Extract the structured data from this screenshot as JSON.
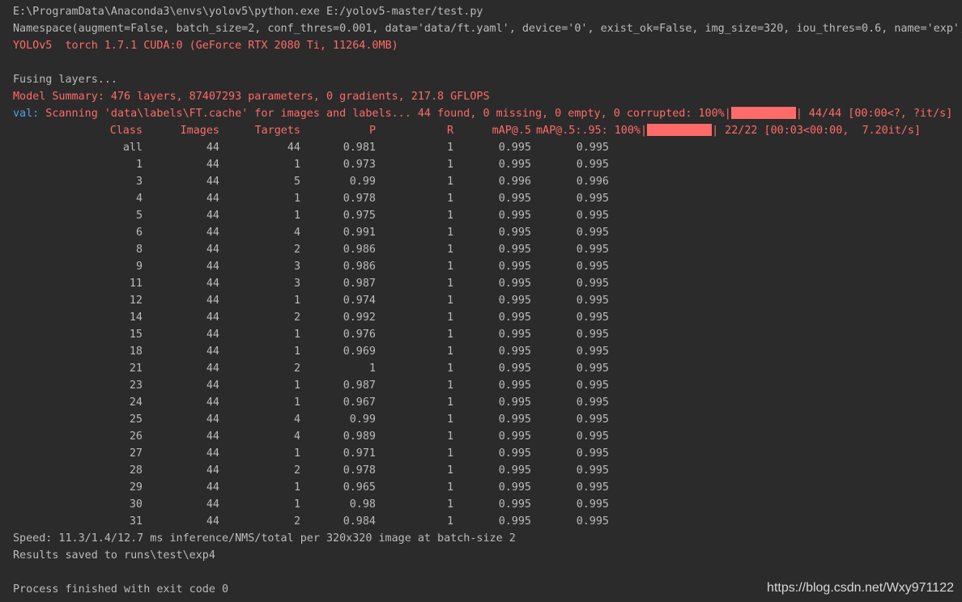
{
  "console": {
    "command": "E:\\ProgramData\\Anaconda3\\envs\\yolov5\\python.exe E:/yolov5-master/test.py",
    "namespace": "Namespace(augment=False, batch_size=2, conf_thres=0.001, data='data/ft.yaml', device='0', exist_ok=False, img_size=320, iou_thres=0.6, name='exp',",
    "env": "YOLOv5  torch 1.7.1 CUDA:0 (GeForce RTX 2080 Ti, 11264.0MB)",
    "fusing": "Fusing layers...",
    "model_summary": "Model Summary: 476 layers, 87407293 parameters, 0 gradients, 217.8 GFLOPS",
    "val_prefix": "val:",
    "val_scan": " Scanning 'data\\labels\\FT.cache' for images and labels... 44 found, 0 missing, 0 empty, 0 corrupted: 100%|",
    "val_progress": "| 44/44 [00:00<?, ?it/s]",
    "val_progress_fraction": 1.0,
    "header": {
      "class": "Class",
      "images": "Images",
      "targets": "Targets",
      "p": "P",
      "r": "R",
      "map50": "mAP@.5",
      "map595": "mAP@.5:.95: 100%|",
      "progress": "| 22/22 [00:03<00:00,  7.20it/s]",
      "progress_fraction": 1.0
    },
    "rows": [
      {
        "class": "all",
        "images": "44",
        "targets": "44",
        "p": "0.981",
        "r": "1",
        "map50": "0.995",
        "map595": "0.995"
      },
      {
        "class": "1",
        "images": "44",
        "targets": "1",
        "p": "0.973",
        "r": "1",
        "map50": "0.995",
        "map595": "0.995"
      },
      {
        "class": "3",
        "images": "44",
        "targets": "5",
        "p": "0.99",
        "r": "1",
        "map50": "0.996",
        "map595": "0.996"
      },
      {
        "class": "4",
        "images": "44",
        "targets": "1",
        "p": "0.978",
        "r": "1",
        "map50": "0.995",
        "map595": "0.995"
      },
      {
        "class": "5",
        "images": "44",
        "targets": "1",
        "p": "0.975",
        "r": "1",
        "map50": "0.995",
        "map595": "0.995"
      },
      {
        "class": "6",
        "images": "44",
        "targets": "4",
        "p": "0.991",
        "r": "1",
        "map50": "0.995",
        "map595": "0.995"
      },
      {
        "class": "8",
        "images": "44",
        "targets": "2",
        "p": "0.986",
        "r": "1",
        "map50": "0.995",
        "map595": "0.995"
      },
      {
        "class": "9",
        "images": "44",
        "targets": "3",
        "p": "0.986",
        "r": "1",
        "map50": "0.995",
        "map595": "0.995"
      },
      {
        "class": "11",
        "images": "44",
        "targets": "3",
        "p": "0.987",
        "r": "1",
        "map50": "0.995",
        "map595": "0.995"
      },
      {
        "class": "12",
        "images": "44",
        "targets": "1",
        "p": "0.974",
        "r": "1",
        "map50": "0.995",
        "map595": "0.995"
      },
      {
        "class": "14",
        "images": "44",
        "targets": "2",
        "p": "0.992",
        "r": "1",
        "map50": "0.995",
        "map595": "0.995"
      },
      {
        "class": "15",
        "images": "44",
        "targets": "1",
        "p": "0.976",
        "r": "1",
        "map50": "0.995",
        "map595": "0.995"
      },
      {
        "class": "18",
        "images": "44",
        "targets": "1",
        "p": "0.969",
        "r": "1",
        "map50": "0.995",
        "map595": "0.995"
      },
      {
        "class": "21",
        "images": "44",
        "targets": "2",
        "p": "1",
        "r": "1",
        "map50": "0.995",
        "map595": "0.995"
      },
      {
        "class": "23",
        "images": "44",
        "targets": "1",
        "p": "0.987",
        "r": "1",
        "map50": "0.995",
        "map595": "0.995"
      },
      {
        "class": "24",
        "images": "44",
        "targets": "1",
        "p": "0.967",
        "r": "1",
        "map50": "0.995",
        "map595": "0.995"
      },
      {
        "class": "25",
        "images": "44",
        "targets": "4",
        "p": "0.99",
        "r": "1",
        "map50": "0.995",
        "map595": "0.995"
      },
      {
        "class": "26",
        "images": "44",
        "targets": "4",
        "p": "0.989",
        "r": "1",
        "map50": "0.995",
        "map595": "0.995"
      },
      {
        "class": "27",
        "images": "44",
        "targets": "1",
        "p": "0.971",
        "r": "1",
        "map50": "0.995",
        "map595": "0.995"
      },
      {
        "class": "28",
        "images": "44",
        "targets": "2",
        "p": "0.978",
        "r": "1",
        "map50": "0.995",
        "map595": "0.995"
      },
      {
        "class": "29",
        "images": "44",
        "targets": "1",
        "p": "0.965",
        "r": "1",
        "map50": "0.995",
        "map595": "0.995"
      },
      {
        "class": "30",
        "images": "44",
        "targets": "1",
        "p": "0.98",
        "r": "1",
        "map50": "0.995",
        "map595": "0.995"
      },
      {
        "class": "31",
        "images": "44",
        "targets": "2",
        "p": "0.984",
        "r": "1",
        "map50": "0.995",
        "map595": "0.995"
      }
    ],
    "speed": "Speed: 11.3/1.4/12.7 ms inference/NMS/total per 320x320 image at batch-size 2",
    "results": "Results saved to runs\\test\\exp4",
    "exit": "Process finished with exit code 0"
  },
  "watermark": "https://blog.csdn.net/Wxy971122",
  "colors": {
    "background": "#2b2b2b",
    "text": "#bbbbbb",
    "stderr": "#ff6b68",
    "prefix": "#4aa4e8"
  }
}
